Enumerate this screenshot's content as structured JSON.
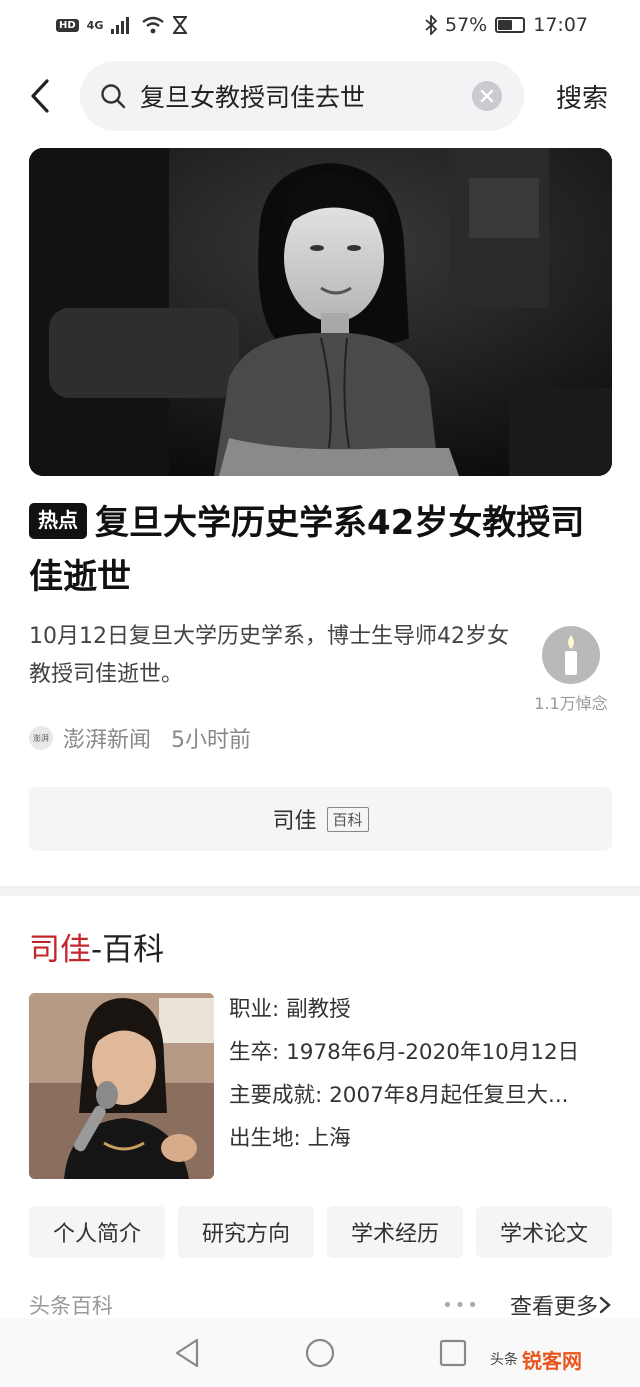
{
  "status_bar": {
    "hd": "HD",
    "network": "4G",
    "battery_percent": "57%",
    "battery_level": 0.57,
    "time": "17:07"
  },
  "search": {
    "query": "复旦女教授司佳去世",
    "search_button": "搜索"
  },
  "news": {
    "hot_badge": "热点",
    "headline": "复旦大学历史学系42岁女教授司佳逝世",
    "summary": "10月12日复旦大学历史学系，博士生导师42岁女教授司佳逝世。",
    "mourn_count": "1.1万悼念",
    "source_logo": "澎湃",
    "source": "澎湃新闻",
    "time": "5小时前",
    "related_name": "司佳",
    "related_tag": "百科"
  },
  "wiki": {
    "title_name": "司佳",
    "title_suffix": "-百科",
    "info": [
      {
        "label": "职业:",
        "value": "副教授"
      },
      {
        "label": "生卒:",
        "value": "1978年6月-2020年10月12日"
      },
      {
        "label": "主要成就:",
        "value": "2007年8月起任复旦大..."
      },
      {
        "label": "出生地:",
        "value": "上海"
      }
    ],
    "chips": [
      "个人简介",
      "研究方向",
      "学术经历",
      "学术论文"
    ],
    "source": "头条百科",
    "more": "查看更多"
  },
  "watermark": {
    "text": "头条",
    "logo": "锐客网"
  },
  "colors": {
    "accent_red": "#c3272b",
    "chip_bg": "#f4f5f7"
  }
}
